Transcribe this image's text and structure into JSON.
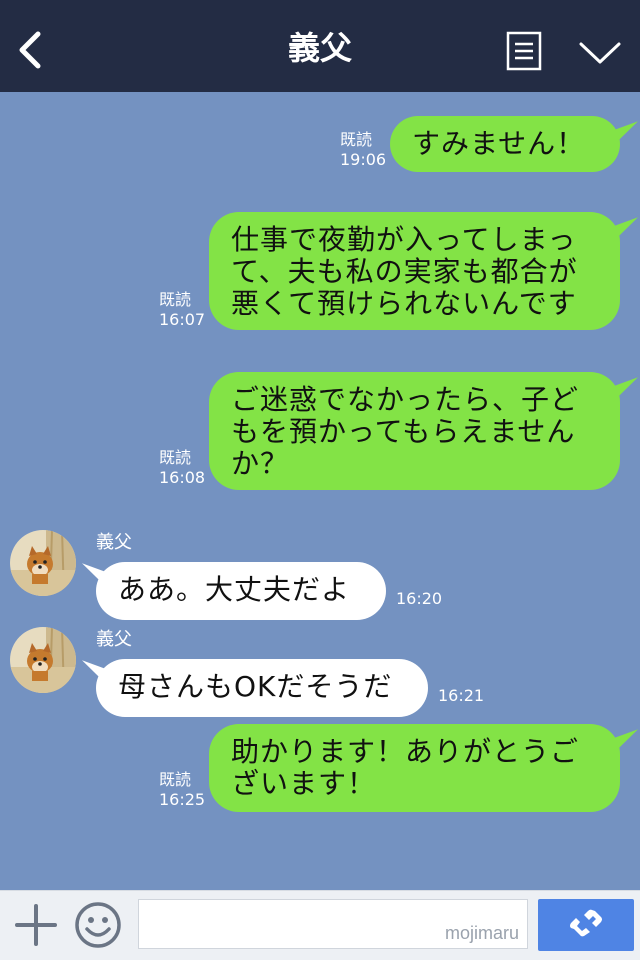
{
  "header": {
    "title": "義父",
    "back_icon": "chevron-left-icon",
    "menu_icon": "document-list-icon",
    "collapse_icon": "chevron-down-icon"
  },
  "messages": [
    {
      "side": "out",
      "text": "すみません！",
      "read": "既読",
      "time": "19:06"
    },
    {
      "side": "out",
      "text": "仕事で夜勤が入ってしまって、夫も私の実家も都合が悪くて預けられないんです",
      "read": "既読",
      "time": "16:07"
    },
    {
      "side": "out",
      "text": "ご迷惑でなかったら、子どもを預かってもらえませんか？",
      "read": "既読",
      "time": "16:08"
    },
    {
      "side": "in",
      "sender": "義父",
      "text": "ああ。大丈夫だよ",
      "time": "16:20"
    },
    {
      "side": "in",
      "sender": "義父",
      "text": "母さんもOKだそうだ",
      "time": "16:21"
    },
    {
      "side": "out",
      "text": "助かります！ありがとうございます！",
      "read": "既読",
      "time": "16:25"
    }
  ],
  "footer": {
    "plus_icon": "plus-icon",
    "emoji_icon": "smiley-icon",
    "input_placeholder": "",
    "watermark": "mojimaru",
    "call_icon": "phone-icon"
  },
  "colors": {
    "header_bg": "#232c44",
    "chat_bg": "#7492c1",
    "out_bubble": "#83e346",
    "in_bubble": "#ffffff",
    "call_button": "#4f84e4"
  }
}
